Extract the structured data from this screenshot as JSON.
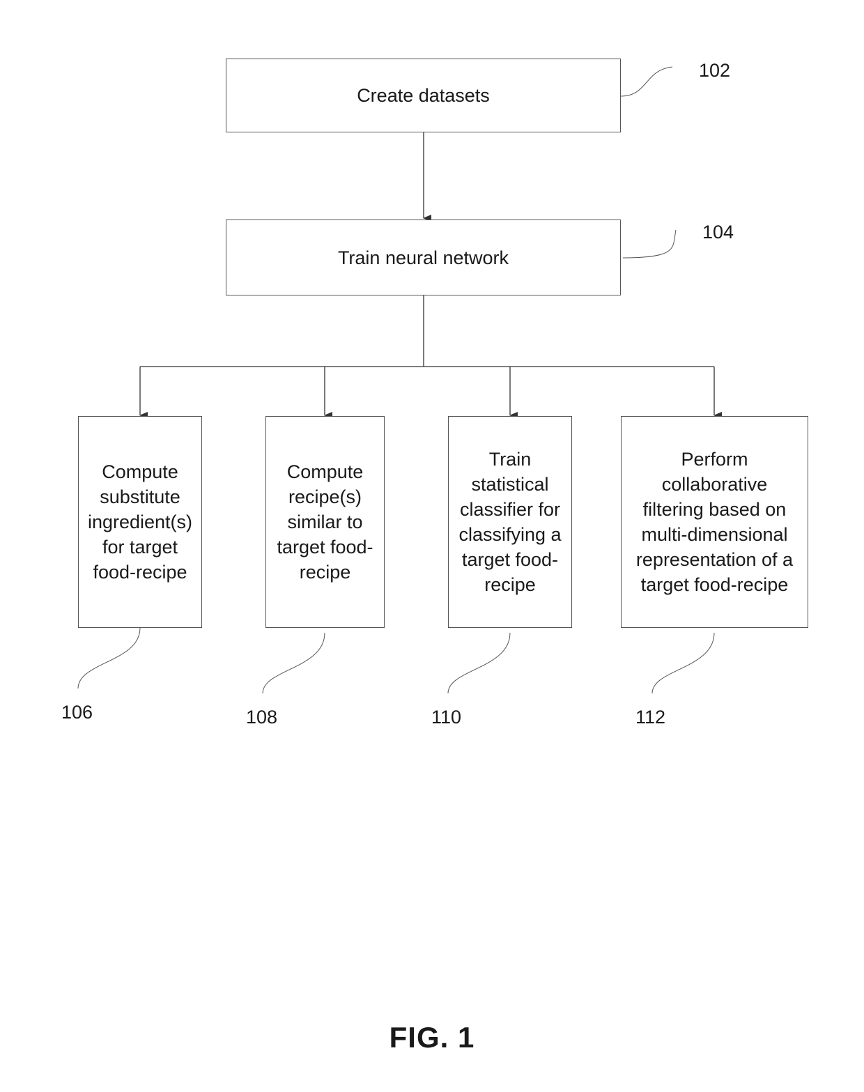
{
  "diagram": {
    "figure_label": "FIG. 1",
    "steps": [
      {
        "ref": "102",
        "label": "Create datasets"
      },
      {
        "ref": "104",
        "label": "Train neural network"
      },
      {
        "ref": "106",
        "label": "Compute\nsubstitute\ningredient(s)\nfor target\nfood-recipe"
      },
      {
        "ref": "108",
        "label": "Compute\nrecipe(s)\nsimilar to\ntarget food-\nrecipe"
      },
      {
        "ref": "110",
        "label": "Train\nstatistical\nclassifier for\nclassifying a\ntarget food-\nrecipe"
      },
      {
        "ref": "112",
        "label": "Perform\ncollaborative\nfiltering based on\nmulti-dimensional\nrepresentation of a\ntarget food-recipe"
      }
    ],
    "edges": [
      {
        "from": "102",
        "to": "104"
      },
      {
        "from": "104",
        "to": "106"
      },
      {
        "from": "104",
        "to": "108"
      },
      {
        "from": "104",
        "to": "110"
      },
      {
        "from": "104",
        "to": "112"
      }
    ]
  }
}
